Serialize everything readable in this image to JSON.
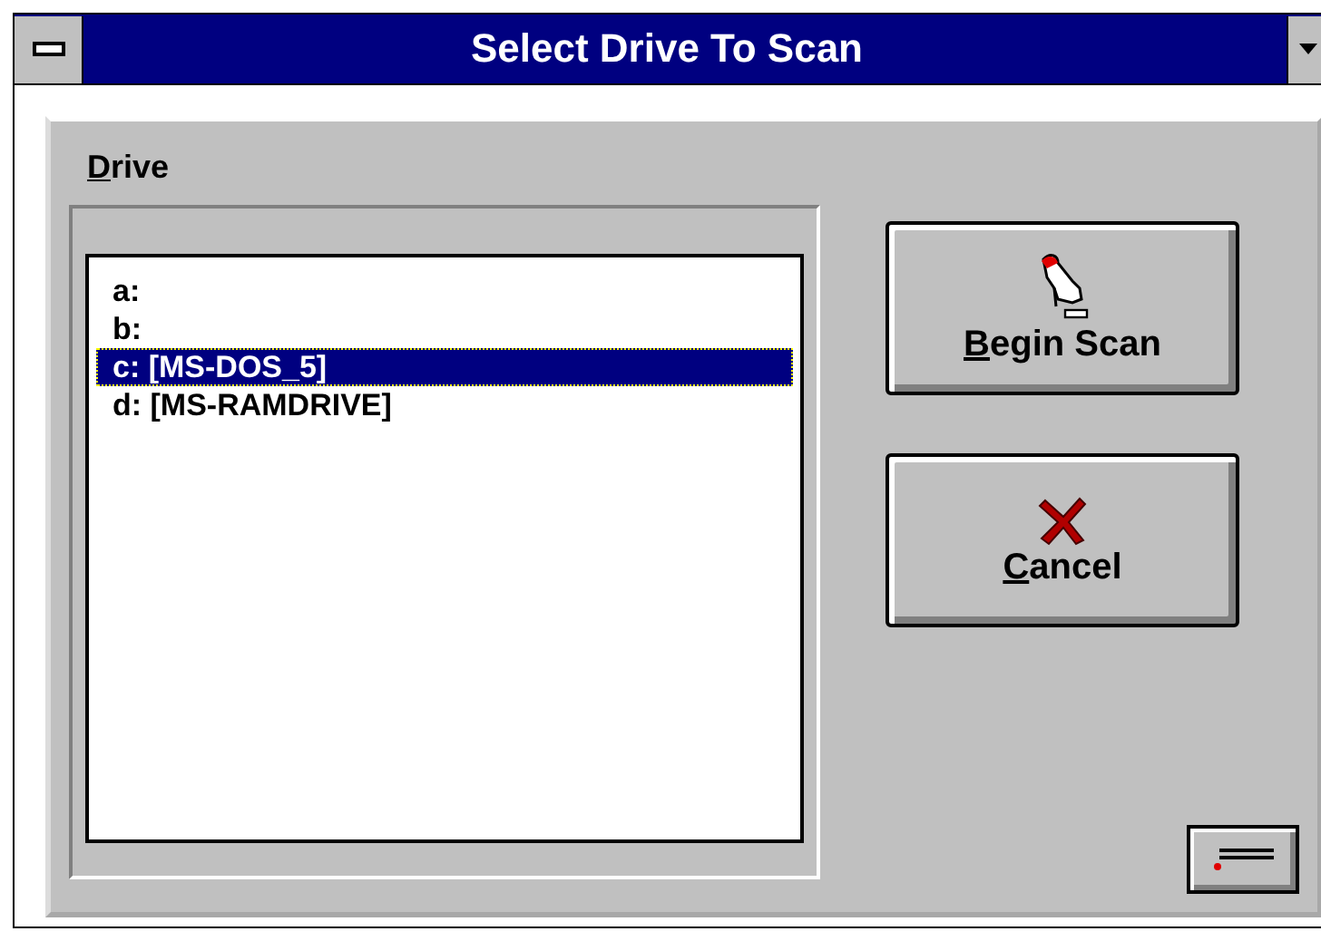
{
  "window": {
    "title": "Select Drive To Scan"
  },
  "drive_group": {
    "label": "Drive"
  },
  "drives": [
    {
      "label": "a:",
      "selected": false
    },
    {
      "label": "b:",
      "selected": false
    },
    {
      "label": "c: [MS-DOS_5]",
      "selected": true
    },
    {
      "label": "d: [MS-RAMDRIVE]",
      "selected": false
    }
  ],
  "buttons": [
    {
      "kind": "scan",
      "label": "Begin Scan"
    },
    {
      "kind": "cancel",
      "label": "Cancel"
    }
  ]
}
